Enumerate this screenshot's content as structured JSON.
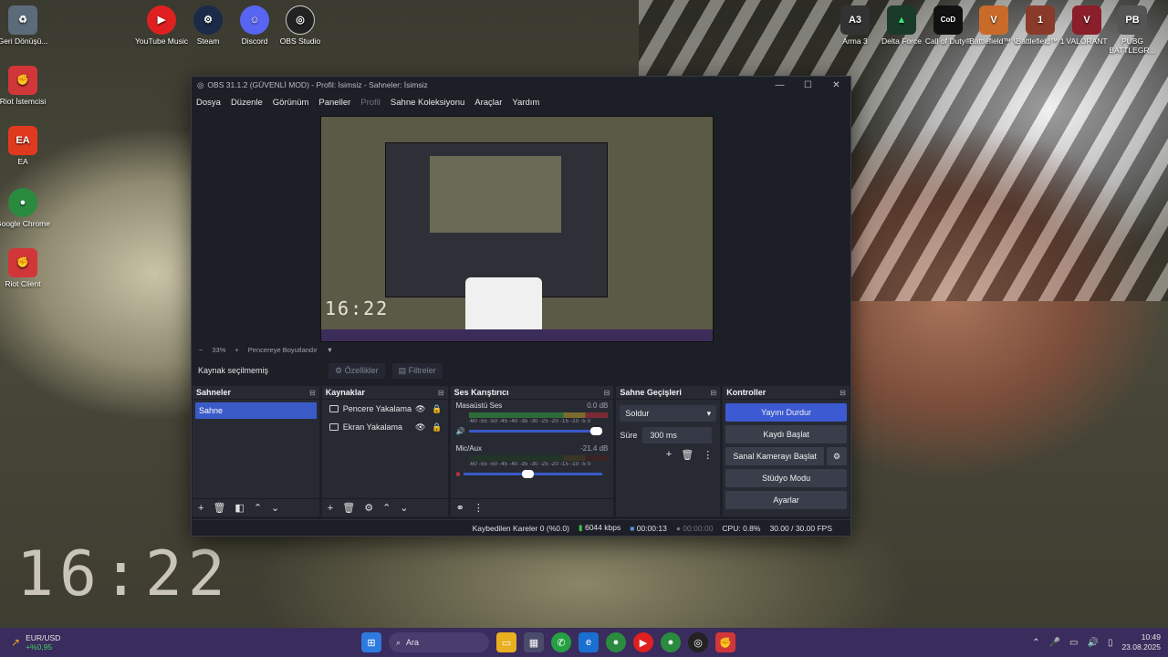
{
  "desktop": {
    "left_icons": [
      {
        "label": "Geri Dönüşü...",
        "icon": "recycle-bin-icon",
        "color": "#5c6b7a"
      },
      {
        "label": "Riot İstemcisi",
        "icon": "riot-icon",
        "color": "#d13639"
      },
      {
        "label": "EA",
        "icon": "ea-icon",
        "color": "#e03a1e"
      },
      {
        "label": "Google Chrome",
        "icon": "chrome-icon",
        "color": "#2a8b3f"
      },
      {
        "label": "Riot Client",
        "icon": "riot-icon",
        "color": "#d13639"
      }
    ],
    "top_icons": [
      {
        "label": "YouTube Music",
        "icon": "youtube-music-icon",
        "color": "#e02020"
      },
      {
        "label": "Steam",
        "icon": "steam-icon",
        "color": "#1b2a48"
      },
      {
        "label": "Discord",
        "icon": "discord-icon",
        "color": "#5865f2"
      },
      {
        "label": "OBS Studio",
        "icon": "obs-icon",
        "color": "#222"
      }
    ],
    "right_icons": [
      {
        "label": "Arma 3",
        "icon": "arma-icon",
        "color": "#333"
      },
      {
        "label": "Delta Force",
        "icon": "delta-force-icon",
        "color": "#1a3a2a"
      },
      {
        "label": "Call of Duty®",
        "icon": "cod-icon",
        "color": "#111"
      },
      {
        "label": "Battlefield™ V",
        "icon": "battlefield-v-icon",
        "color": "#c86b2a"
      },
      {
        "label": "Battlefield™ 1",
        "icon": "battlefield-1-icon",
        "color": "#8a3a2a"
      },
      {
        "label": "VALORANT",
        "icon": "valorant-icon",
        "color": "#8a1e2a"
      },
      {
        "label": "PUBG BATTLEGR...",
        "icon": "pubg-icon",
        "color": "#555"
      }
    ],
    "wallpaper_clock": "16:22"
  },
  "obs": {
    "title": "OBS 31.1.2 (GÜVENLİ MOD) - Profil: İsimsiz - Sahneler: İsimsiz",
    "menu": [
      "Dosya",
      "Düzenle",
      "Görünüm",
      "Paneller",
      "Profil",
      "Sahne Koleksiyonu",
      "Araçlar",
      "Yardım"
    ],
    "preview_clock": "16:22",
    "zoom": {
      "minus": "−",
      "value": "33%",
      "plus": "+",
      "fit": "Pencereye Boyutlandır"
    },
    "source_bar": {
      "label": "Kaynak seçilmemiş",
      "properties": "Özellikler",
      "filters": "Filtreler"
    },
    "scenes": {
      "title": "Sahneler",
      "items": [
        "Sahne"
      ]
    },
    "sources": {
      "title": "Kaynaklar",
      "items": [
        "Pencere Yakalama",
        "Ekran Yakalama"
      ]
    },
    "mixer": {
      "title": "Ses Karıştırıcı",
      "channels": [
        {
          "name": "Masaüstü Ses",
          "db": "0.0 dB",
          "level": 0.82,
          "volume": 1.0
        },
        {
          "name": "Mic/Aux",
          "db": "-21.4 dB",
          "level": 0.0,
          "volume": 0.46
        }
      ],
      "ticks": "-60 -55 -50 -45 -40 -35 -30 -25 -20 -15 -10 -5 0"
    },
    "transitions": {
      "title": "Sahne Geçişleri",
      "selected": "Soldur",
      "duration_label": "Süre",
      "duration": "300 ms"
    },
    "controls": {
      "title": "Kontroller",
      "stop_stream": "Yayını Durdur",
      "start_record": "Kaydı Başlat",
      "virtual_cam": "Sanal Kamerayı Başlat",
      "studio_mode": "Stüdyo Modu",
      "settings": "Ayarlar"
    },
    "status": {
      "dropped": "Kaybedilen Kareler 0 (%0.0)",
      "bitrate": "6044 kbps",
      "stream_time": "00:00:13",
      "record_time": "00:00:00",
      "cpu": "CPU: 0.8%",
      "fps": "30.00 / 30.00 FPS"
    }
  },
  "taskbar": {
    "ticker": {
      "pair": "EUR/USD",
      "change": "+%0,95"
    },
    "search_placeholder": "Ara",
    "time": "10:49",
    "date": "23.08.2025",
    "accent": "#3a2c5c"
  }
}
